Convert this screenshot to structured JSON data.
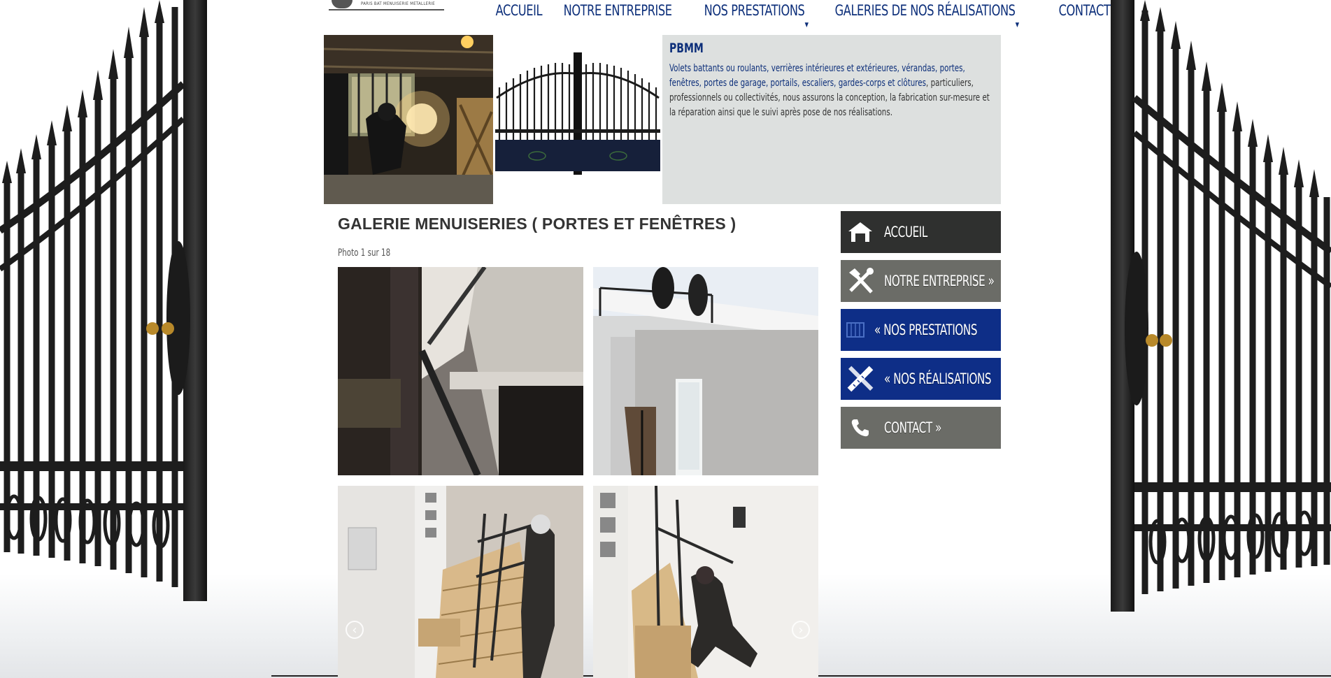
{
  "header": {
    "logo_text": "PARIS BAT MENUISERIE METALLERIE",
    "nav": [
      {
        "label": "ACCUEIL",
        "has_submenu": false
      },
      {
        "label": "NOTRE ENTREPRISE",
        "has_submenu": false
      },
      {
        "label": "NOS PRESTATIONS",
        "has_submenu": true
      },
      {
        "label": "GALERIES DE NOS RÉALISATIONS",
        "has_submenu": true
      },
      {
        "label": "CONTACT",
        "has_submenu": false
      }
    ]
  },
  "banner": {
    "title": "PBMM",
    "text_highlight": "Volets battants ou roulants, verrières intérieures et extérieures, vérandas, portes, fenêtres, portes de garage, portails, escaliers, gardes-corps et clôtures",
    "text_rest": ", particuliers, professionnels ou collectivités, nous assurons la conception, la fabrication sur-mesure et la réparation ainsi que le suivi après pose de nos réalisations."
  },
  "gallery": {
    "title": "GALERIE MENUISERIES ( PORTES ET FENÊTRES )",
    "photo_count": "Photo 1 sur 18",
    "prev_icon": "chevron-left-icon",
    "next_icon": "chevron-right-icon"
  },
  "side_menu": [
    {
      "label": "ACCUEIL",
      "icon": "home-icon",
      "color": "#2f302f"
    },
    {
      "label": "NOTRE ENTREPRISE »",
      "icon": "tools-icon",
      "color": "#6b6c67"
    },
    {
      "label": "« NOS PRESTATIONS",
      "icon": "window-icon",
      "color": "#0e2e87"
    },
    {
      "label": "« NOS RÉALISATIONS",
      "icon": "ruler-pencil-icon",
      "color": "#0e2e87"
    },
    {
      "label": "CONTACT »",
      "icon": "phone-icon",
      "color": "#6b6c67"
    }
  ],
  "colors": {
    "brand_blue": "#0d2f7a",
    "info_bg": "#dde0df"
  }
}
